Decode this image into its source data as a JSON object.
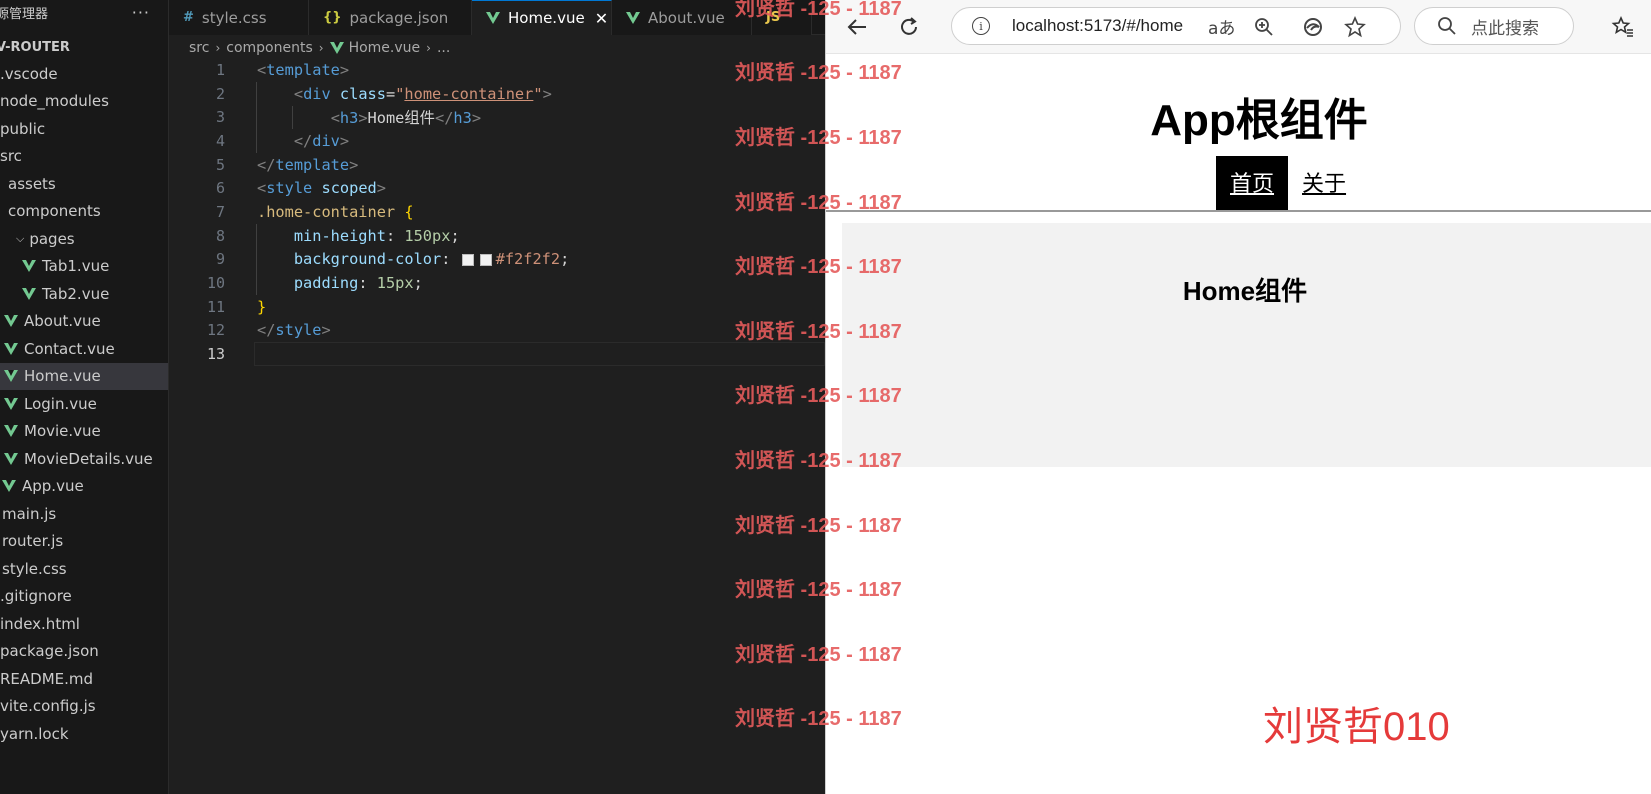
{
  "explorer": {
    "title": "源管理器",
    "more": "···",
    "root": "V-ROUTER",
    "items": [
      {
        "label": ".vscode",
        "kind": "folder"
      },
      {
        "label": "node_modules",
        "kind": "folder"
      },
      {
        "label": "public",
        "kind": "folder"
      },
      {
        "label": "src",
        "kind": "folder"
      },
      {
        "label": "assets",
        "kind": "folder"
      },
      {
        "label": "components",
        "kind": "folder"
      },
      {
        "label": "pages",
        "kind": "folder-open"
      },
      {
        "label": "Tab1.vue",
        "kind": "vue"
      },
      {
        "label": "Tab2.vue",
        "kind": "vue"
      },
      {
        "label": "About.vue",
        "kind": "vue"
      },
      {
        "label": "Contact.vue",
        "kind": "vue"
      },
      {
        "label": "Home.vue",
        "kind": "vue",
        "active": true
      },
      {
        "label": "Login.vue",
        "kind": "vue"
      },
      {
        "label": "Movie.vue",
        "kind": "vue"
      },
      {
        "label": "MovieDetails.vue",
        "kind": "vue"
      },
      {
        "label": "App.vue",
        "kind": "vue"
      },
      {
        "label": "main.js",
        "kind": "js"
      },
      {
        "label": "router.js",
        "kind": "js"
      },
      {
        "label": "style.css",
        "kind": "file"
      },
      {
        "label": ".gitignore",
        "kind": "file"
      },
      {
        "label": "index.html",
        "kind": "file"
      },
      {
        "label": "package.json",
        "kind": "file"
      },
      {
        "label": "README.md",
        "kind": "file"
      },
      {
        "label": "vite.config.js",
        "kind": "file"
      },
      {
        "label": "yarn.lock",
        "kind": "file"
      }
    ]
  },
  "editor": {
    "tabs": [
      {
        "icon": "#",
        "label": "style.css"
      },
      {
        "icon": "{}",
        "label": "package.json"
      },
      {
        "icon": "V",
        "label": "Home.vue",
        "active": true,
        "close": "✕"
      },
      {
        "icon": "V",
        "label": "About.vue"
      },
      {
        "icon": "JS",
        "label": ""
      }
    ],
    "breadcrumb": [
      "src",
      "components",
      "Home.vue",
      "..."
    ],
    "code": {
      "l1": {
        "n": "1"
      },
      "l2": {
        "n": "2"
      },
      "l3": {
        "n": "3"
      },
      "l4": {
        "n": "4"
      },
      "l5": {
        "n": "5"
      },
      "l6": {
        "n": "6"
      },
      "l7": {
        "n": "7"
      },
      "l8": {
        "n": "8"
      },
      "l9": {
        "n": "9"
      },
      "l10": {
        "n": "10"
      },
      "l11": {
        "n": "11"
      },
      "l12": {
        "n": "12"
      },
      "l13": {
        "n": "13"
      },
      "t_template": "template",
      "t_div": "div",
      "t_class": "class",
      "t_class_val": "home-container",
      "t_h3": "h3",
      "t_h3_text": "Home组件",
      "t_style": "style",
      "t_scoped": "scoped",
      "t_selector": ".home-container",
      "t_open_brace": "{",
      "t_close_brace": "}",
      "t_minh_prop": "min-height",
      "t_minh_val": "150px",
      "t_bg_prop": "background-color",
      "t_bg_val": "#f2f2f2",
      "t_pad_prop": "padding",
      "t_pad_val": "15px"
    }
  },
  "browser": {
    "url": "localhost:5173/#/home",
    "search_placeholder": "点此搜索",
    "page": {
      "title": "App根组件",
      "nav": [
        {
          "label": "首页",
          "active": true
        },
        {
          "label": "关于"
        }
      ],
      "home_heading": "Home组件"
    },
    "signature": "刘贤哲010"
  },
  "watermark": "刘贤哲 -125 - 1187",
  "colors": {
    "accent": "#0078d4",
    "vue_green": "#73c991",
    "home_bg": "#f2f2f2",
    "watermark": "#e55b5b"
  }
}
